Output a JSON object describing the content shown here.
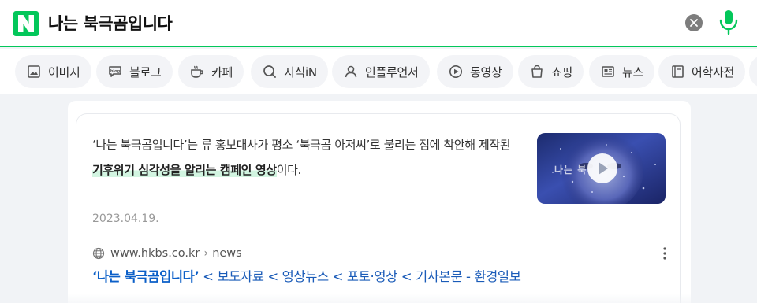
{
  "search": {
    "query": "나는 북극곰입니다",
    "logo_letter": "N"
  },
  "colors": {
    "brand_green": "#03c75a",
    "link_blue": "#0b5fc8",
    "highlight_green": "#03c75a"
  },
  "tabs": [
    {
      "label": "이미지",
      "icon": "image-icon"
    },
    {
      "label": "블로그",
      "icon": "blog-icon"
    },
    {
      "label": "카페",
      "icon": "cafe-icon"
    },
    {
      "label": "지식iN",
      "icon": "knowledge-icon"
    },
    {
      "label": "인플루언서",
      "icon": "influencer-icon"
    },
    {
      "label": "동영상",
      "icon": "video-icon"
    },
    {
      "label": "쇼핑",
      "icon": "shopping-icon"
    },
    {
      "label": "뉴스",
      "icon": "news-icon"
    },
    {
      "label": "어학사전",
      "icon": "dictionary-icon"
    }
  ],
  "result": {
    "snippet_part1": "‘나는 북극곰입니다’는 류 홍보대사가 평소 ‘북극곰 아저씨’로 불리는 점에 착안해 제작된 ",
    "snippet_bold": "기후위기 심각성을 알리는 캠페인 영상",
    "snippet_part2": "이다.",
    "date": "2023.04.19.",
    "source_url": "www.hkbs.co.kr",
    "source_sep": "›",
    "source_path": "news",
    "title_main": "‘나는 북극곰입니다’",
    "title_rest": " < 보도자료 < 영상뉴스 < 포토·영상 < 기사본문 - 환경일보",
    "thumbnail_text": "나는 북"
  }
}
